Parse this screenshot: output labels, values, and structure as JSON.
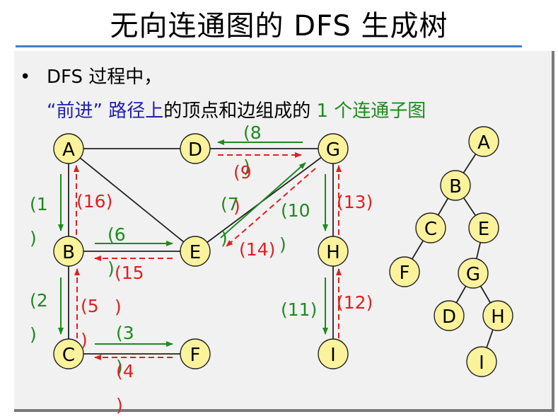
{
  "slide": {
    "title": "无向连通图的 DFS 生成树",
    "bullet": "•",
    "line1": "DFS 过程中，",
    "line2_quote": "“前进”",
    "line2_path": " 路径上",
    "line2_rest": "的顶点和边组成的",
    "line2_count": " 1 个连通子图"
  },
  "colors": {
    "forward": "#1e8a1e",
    "backtrack": "#e02020",
    "node_fill": "#fbf29c",
    "title_rule": "#3f7fc7"
  },
  "graph": {
    "nodes": [
      "A",
      "B",
      "C",
      "D",
      "E",
      "F",
      "G",
      "H",
      "I"
    ],
    "edges": [
      [
        "A",
        "D"
      ],
      [
        "A",
        "B"
      ],
      [
        "A",
        "E"
      ],
      [
        "D",
        "G"
      ],
      [
        "B",
        "C"
      ],
      [
        "B",
        "E"
      ],
      [
        "C",
        "F"
      ],
      [
        "E",
        "G"
      ],
      [
        "G",
        "H"
      ],
      [
        "H",
        "I"
      ]
    ]
  },
  "step_labels": {
    "s1": "(1",
    "s1b": ")",
    "s2": "(2",
    "s2b": ")",
    "s3": "(3",
    "s3b": ")",
    "s4": "(4",
    "s4b": ")",
    "s5": "(5",
    "s5b": ")",
    "s6": "(6",
    "s6b": ")",
    "s7": "(7",
    "s7b": ")",
    "s8": "(8",
    "s8b": ")",
    "s9": "(9",
    "s9b": ")",
    "s10": "(10",
    "s10b": ")",
    "s11": "(11)",
    "s12": "(12)",
    "s13": "(13)",
    "s14": "(14)",
    "s15": "(15",
    "s15b": ")",
    "s16": "(16)"
  },
  "tree": {
    "nodes": [
      "A",
      "B",
      "C",
      "E",
      "F",
      "G",
      "D",
      "H",
      "I"
    ],
    "edges": [
      [
        "A",
        "B"
      ],
      [
        "B",
        "C"
      ],
      [
        "B",
        "E"
      ],
      [
        "C",
        "F"
      ],
      [
        "E",
        "G"
      ],
      [
        "G",
        "D"
      ],
      [
        "G",
        "H"
      ],
      [
        "H",
        "I"
      ]
    ]
  }
}
